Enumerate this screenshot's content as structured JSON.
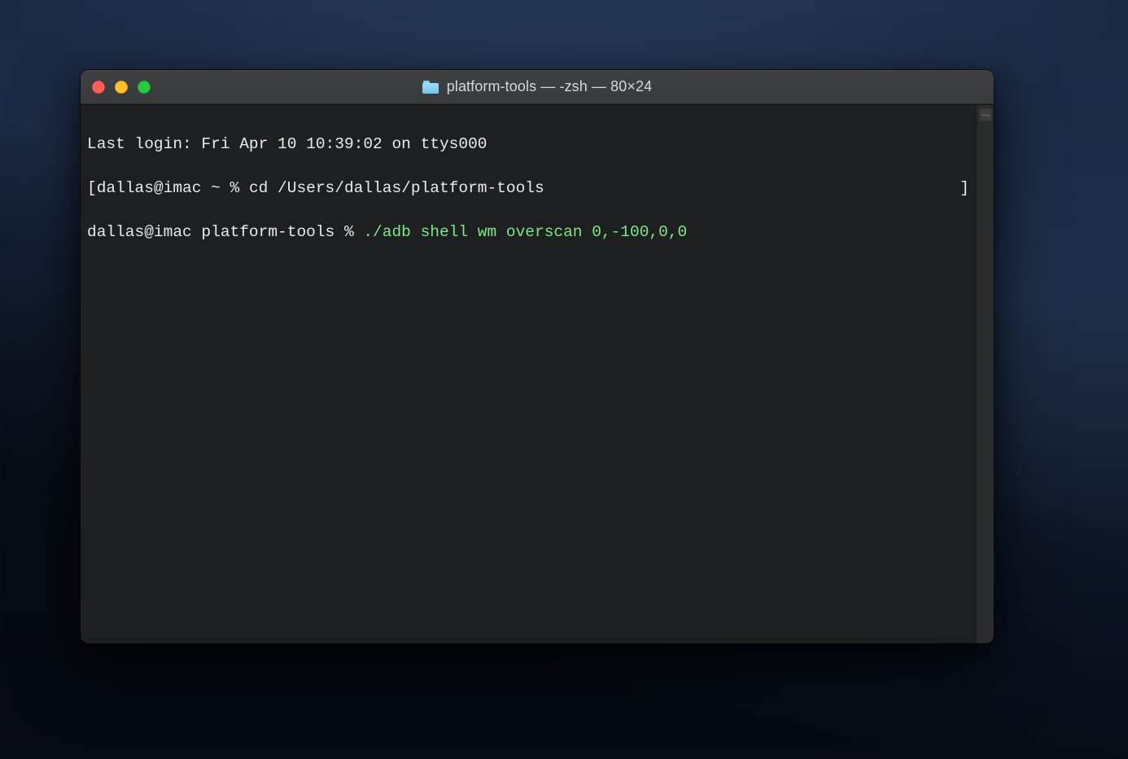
{
  "window": {
    "title": "platform-tools — -zsh — 80×24"
  },
  "terminal": {
    "lines": [
      {
        "text": "Last login: Fri Apr 10 10:39:02 on ttys000"
      },
      {
        "open_bracket": "[",
        "prompt": "dallas@imac ~ % ",
        "command": "cd /Users/dallas/platform-tools",
        "close_bracket": "]"
      },
      {
        "prompt": "dallas@imac platform-tools % ",
        "command": "./adb shell wm overscan 0,-100,0,0"
      }
    ]
  }
}
